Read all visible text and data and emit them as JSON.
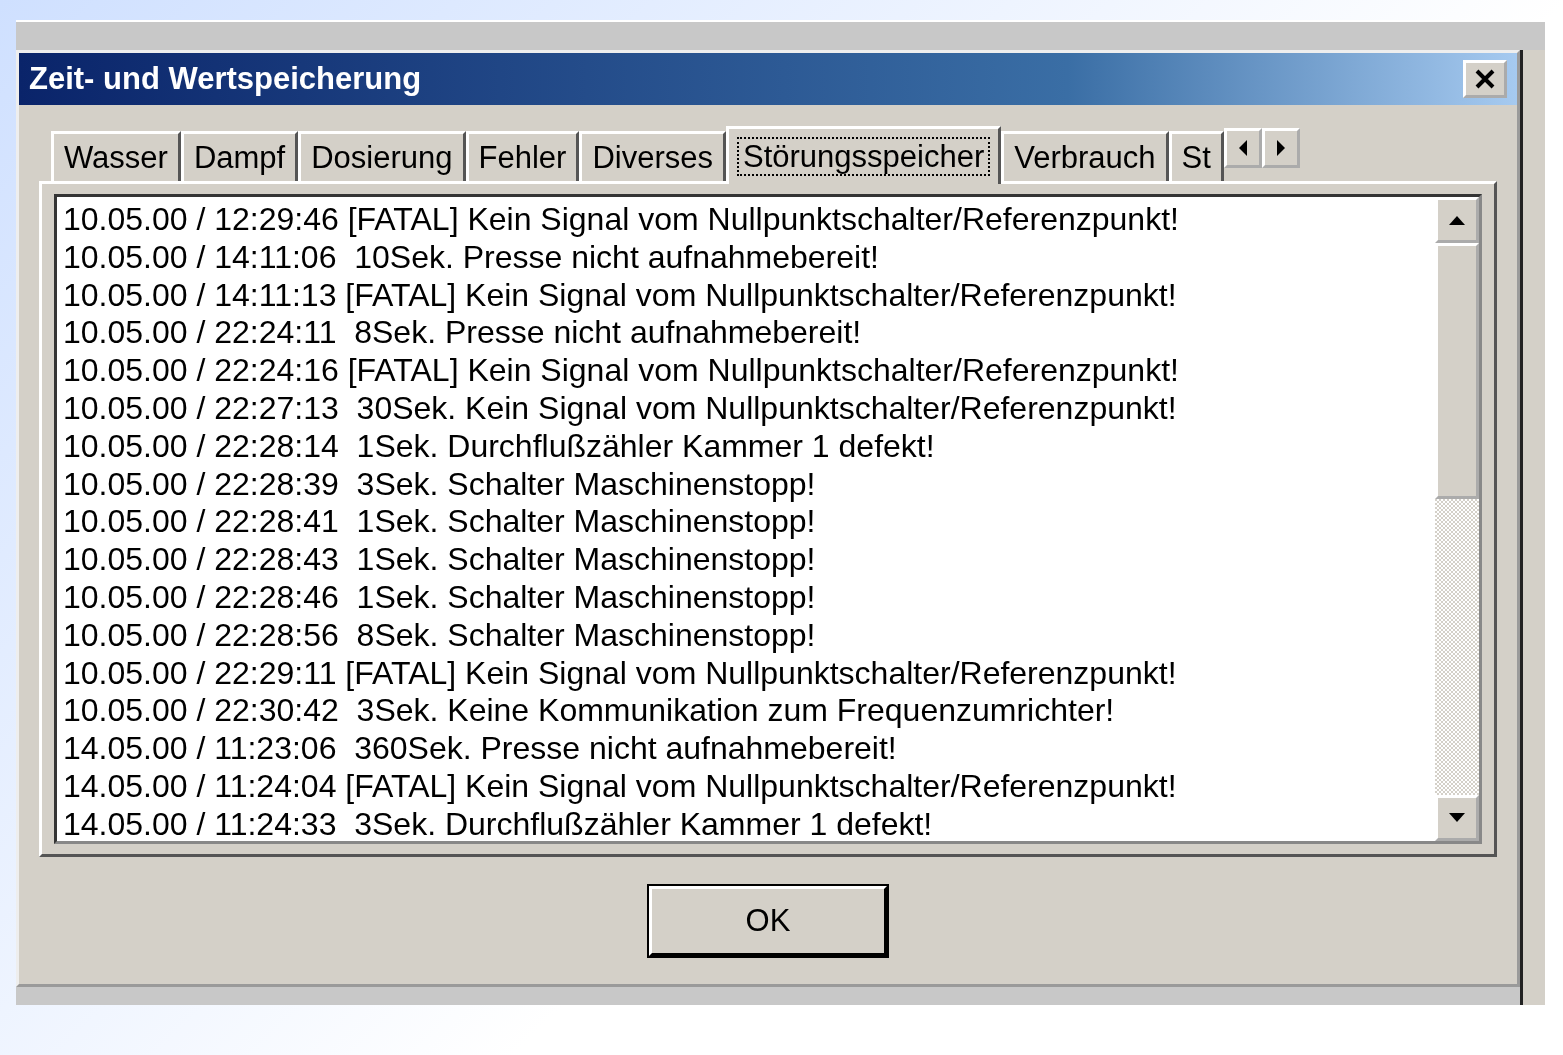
{
  "window": {
    "title": "Zeit- und Wertspeicherung"
  },
  "tabs": [
    {
      "label": "Wasser",
      "selected": false
    },
    {
      "label": "Dampf",
      "selected": false
    },
    {
      "label": "Dosierung",
      "selected": false
    },
    {
      "label": "Fehler",
      "selected": false
    },
    {
      "label": "Diverses",
      "selected": false
    },
    {
      "label": "Störungsspeicher",
      "selected": true
    },
    {
      "label": "Verbrauch",
      "selected": false
    },
    {
      "label": "St",
      "selected": false
    }
  ],
  "log": [
    "10.05.00 / 12:29:46 [FATAL] Kein Signal vom Nullpunktschalter/Referenzpunkt!",
    "10.05.00 / 14:11:06  10Sek. Presse nicht aufnahmebereit!",
    "10.05.00 / 14:11:13 [FATAL] Kein Signal vom Nullpunktschalter/Referenzpunkt!",
    "10.05.00 / 22:24:11  8Sek. Presse nicht aufnahmebereit!",
    "10.05.00 / 22:24:16 [FATAL] Kein Signal vom Nullpunktschalter/Referenzpunkt!",
    "10.05.00 / 22:27:13  30Sek. Kein Signal vom Nullpunktschalter/Referenzpunkt!",
    "10.05.00 / 22:28:14  1Sek. Durchflußzähler Kammer 1 defekt!",
    "10.05.00 / 22:28:39  3Sek. Schalter Maschinenstopp!",
    "10.05.00 / 22:28:41  1Sek. Schalter Maschinenstopp!",
    "10.05.00 / 22:28:43  1Sek. Schalter Maschinenstopp!",
    "10.05.00 / 22:28:46  1Sek. Schalter Maschinenstopp!",
    "10.05.00 / 22:28:56  8Sek. Schalter Maschinenstopp!",
    "10.05.00 / 22:29:11 [FATAL] Kein Signal vom Nullpunktschalter/Referenzpunkt!",
    "10.05.00 / 22:30:42  3Sek. Keine Kommunikation zum Frequenzumrichter!",
    "14.05.00 / 11:23:06  360Sek. Presse nicht aufnahmebereit!",
    "14.05.00 / 11:24:04 [FATAL] Kein Signal vom Nullpunktschalter/Referenzpunkt!",
    "14.05.00 / 11:24:33  3Sek. Durchflußzähler Kammer 1 defekt!"
  ],
  "buttons": [
    {
      "label": "OK"
    }
  ]
}
